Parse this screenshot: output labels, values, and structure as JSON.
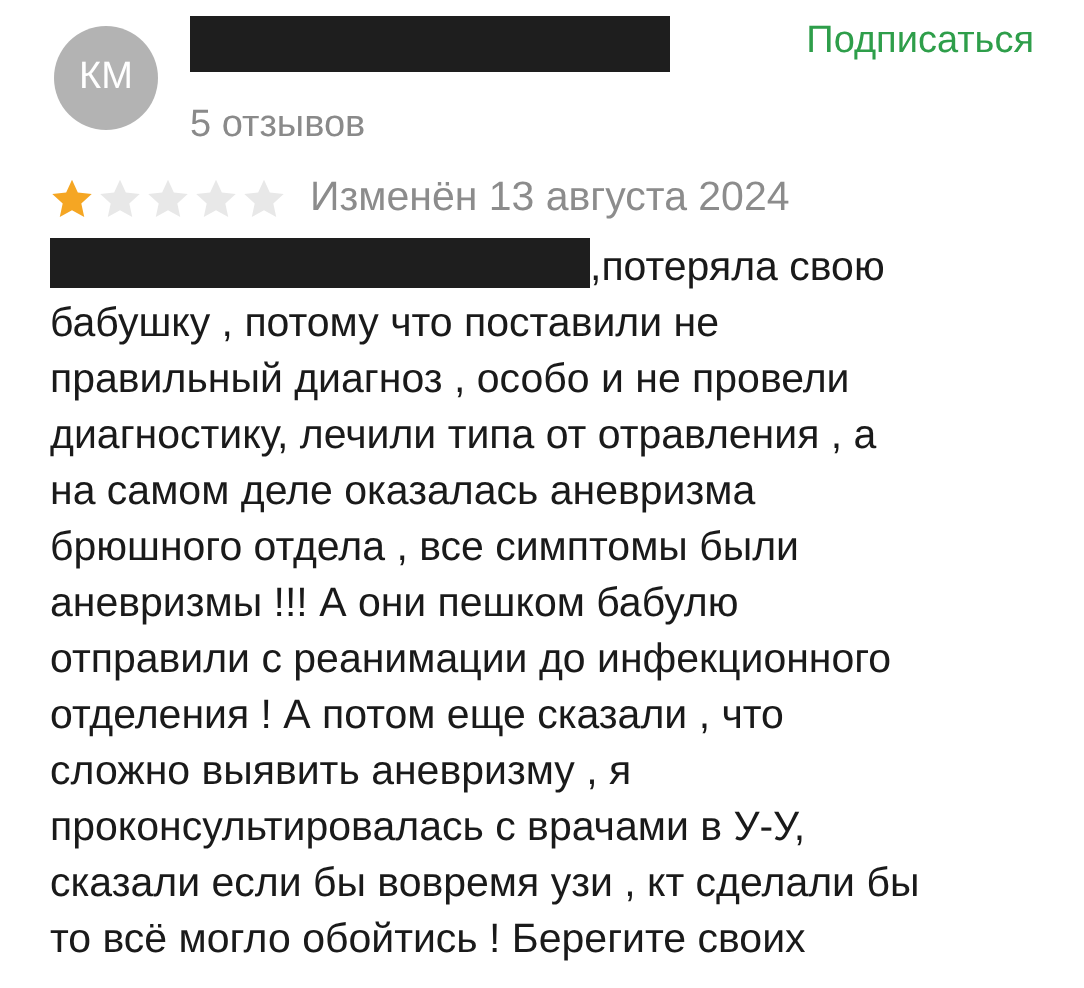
{
  "author": {
    "initials": "КМ",
    "name_redacted": true,
    "reviews_count": "5 отзывов"
  },
  "subscribe": "Подписаться",
  "rating": {
    "stars": 1
  },
  "date": "Изменён 13 августа 2024",
  "review": {
    "lead_redacted": true,
    "lines": [
      ",потеряла свою",
      "бабушку , потому что поставили не",
      "правильный диагноз , особо и не провели",
      "диагностику, лечили типа от отравления , а",
      "на самом деле оказалась аневризма",
      "брюшного отдела , все симптомы были",
      "аневризмы !!! А они пешком бабулю",
      "отправили с реанимации до инфекционного",
      "отделения ! А потом еще сказали , что",
      "сложно выявить аневризму , я",
      "проконсультировалась с врачами в У-У,",
      "сказали если бы вовремя узи , кт сделали бы",
      "то всё могло обойтись ! Берегите своих"
    ]
  }
}
